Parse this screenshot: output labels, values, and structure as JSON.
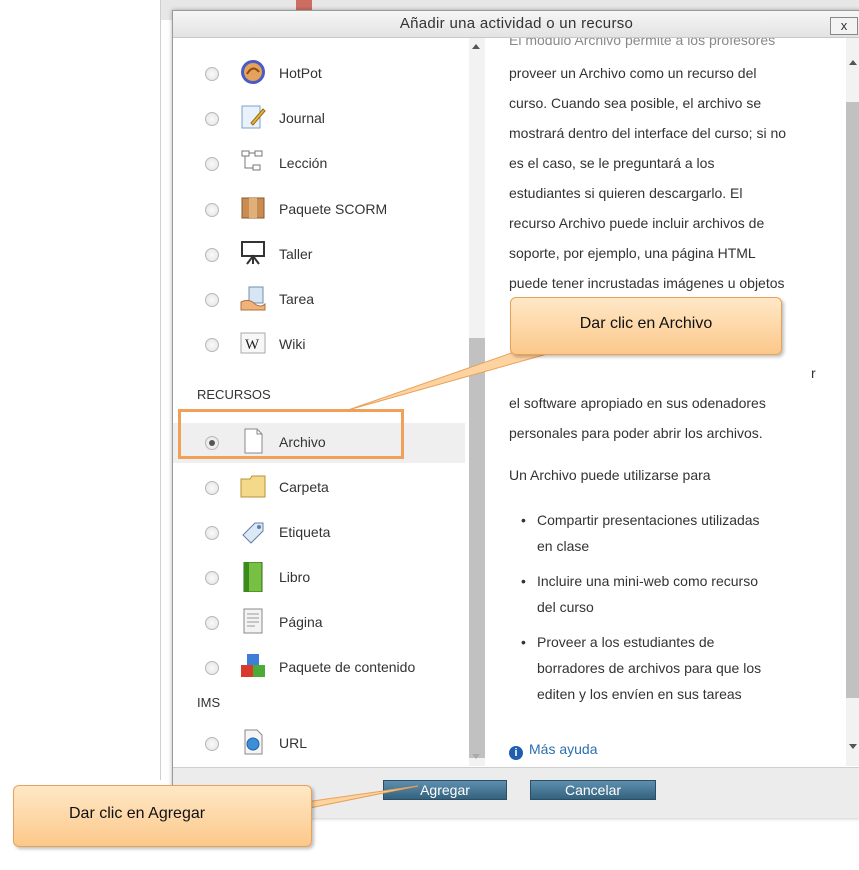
{
  "dialog": {
    "title": "Añadir una actividad o un recurso",
    "close_label": "x"
  },
  "activities": [
    {
      "label": "HotPot",
      "icon": "hotpot-icon"
    },
    {
      "label": "Journal",
      "icon": "journal-icon"
    },
    {
      "label": "Lección",
      "icon": "lesson-icon"
    },
    {
      "label": "Paquete SCORM",
      "icon": "scorm-package-icon"
    },
    {
      "label": "Taller",
      "icon": "workshop-icon"
    },
    {
      "label": "Tarea",
      "icon": "assignment-icon"
    },
    {
      "label": "Wiki",
      "icon": "wiki-icon"
    }
  ],
  "resources_heading": "RECURSOS",
  "resources": [
    {
      "label": "Archivo",
      "icon": "file-icon",
      "selected": true
    },
    {
      "label": "Carpeta",
      "icon": "folder-icon"
    },
    {
      "label": "Etiqueta",
      "icon": "label-icon"
    },
    {
      "label": "Libro",
      "icon": "book-icon"
    },
    {
      "label": "Página",
      "icon": "page-icon"
    },
    {
      "label": "Paquete de contenido",
      "icon": "content-package-icon"
    }
  ],
  "ims_heading": "IMS",
  "ims_items": [
    {
      "label": "URL",
      "icon": "url-icon"
    }
  ],
  "description": {
    "lines": [
      "El módulo Archivo permite a los profesores",
      "proveer un Archivo como un recurso del",
      "curso. Cuando sea posible, el archivo se",
      "mostrará dentro del interface del curso; si no",
      "es el caso, se le preguntará a los",
      "estudiantes si quieren descargarlo. El",
      "recurso Archivo puede incluir archivos de",
      "soporte, por ejemplo, una página HTML",
      "puede tener incrustadas imágenes u objetos",
      "r",
      "el software apropiado en sus odenadores",
      "personales para poder abrir los archivos."
    ],
    "usage_intro": "Un Archivo puede utilizarse para",
    "bullets": [
      [
        "Compartir presentaciones utilizadas",
        "en clase"
      ],
      [
        "Incluire una mini-web como recurso",
        "del curso"
      ],
      [
        "Proveer a los estudiantes de",
        "borradores de archivos para que los",
        "editen y los envíen en sus tareas"
      ]
    ],
    "more_help": "Más ayuda"
  },
  "footer": {
    "add_label": "Agregar",
    "cancel_label": "Cancelar"
  },
  "callouts": {
    "archivo": "Dar clic en Archivo",
    "agregar": "Dar clic en Agregar"
  },
  "colors": {
    "callout_fill": "#fcc88a",
    "callout_border": "#e8a15a",
    "button": "#34627e",
    "link": "#2a6fb0"
  }
}
